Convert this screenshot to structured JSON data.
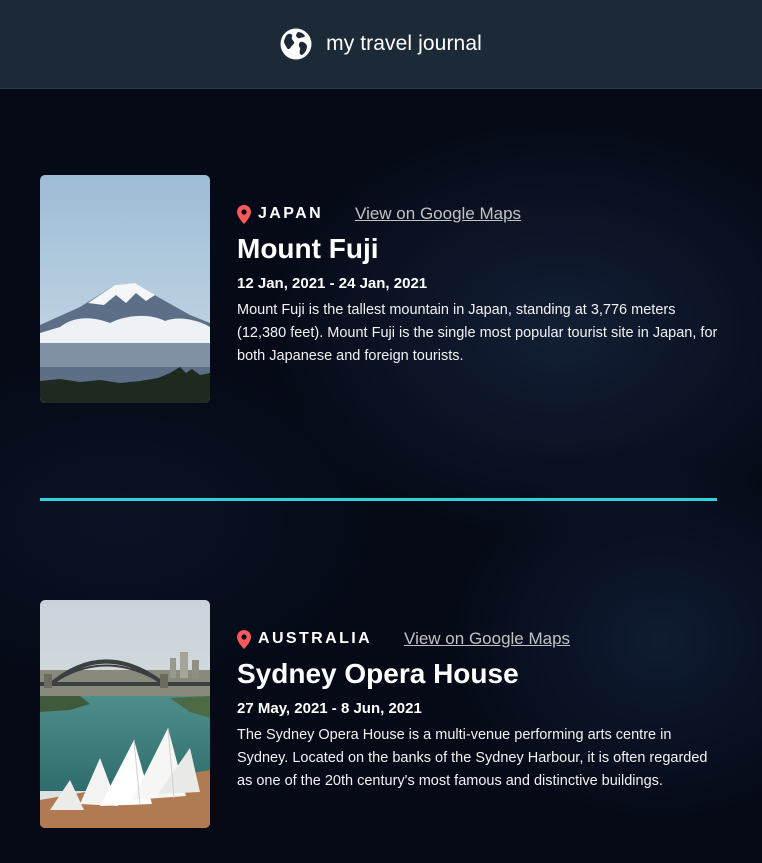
{
  "header": {
    "title": "my travel journal",
    "icon": "globe-icon"
  },
  "colors": {
    "header_bg": "#1c2a38",
    "page_bg": "#060a17",
    "pin": "#f55a5a",
    "divider": "#2ad4d9",
    "link": "#c2c2c2"
  },
  "entries": [
    {
      "country": "JAPAN",
      "link_text": "View on Google Maps",
      "title": "Mount Fuji",
      "dates": "12 Jan, 2021 - 24 Jan, 2021",
      "description": "Mount Fuji is the tallest mountain in Japan, standing at 3,776 meters (12,380 feet). Mount Fuji is the single most popular tourist site in Japan, for both Japanese and foreign tourists.",
      "image": "mount-fuji-photo"
    },
    {
      "country": "AUSTRALIA",
      "link_text": "View on Google Maps",
      "title": "Sydney Opera House",
      "dates": "27 May, 2021 - 8 Jun, 2021",
      "description": "The Sydney Opera House is a multi-venue performing arts centre in Sydney. Located on the banks of the Sydney Harbour, it is often regarded as one of the 20th century's most famous and distinctive buildings.",
      "image": "sydney-opera-house-photo"
    }
  ]
}
